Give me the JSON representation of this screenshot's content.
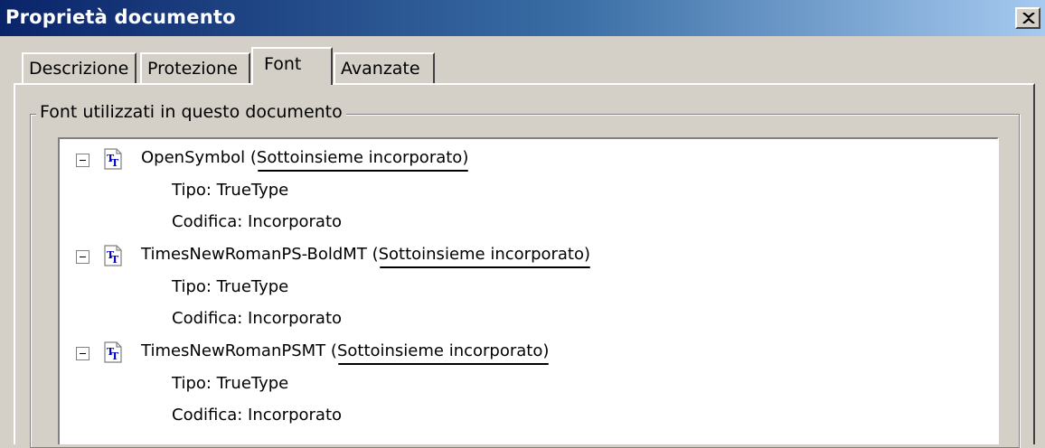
{
  "window": {
    "title": "Proprietà documento",
    "close_glyph": "×"
  },
  "tabs": [
    {
      "label": "Descrizione"
    },
    {
      "label": "Protezione"
    },
    {
      "label": "Font",
      "active": true
    },
    {
      "label": "Avanzate"
    }
  ],
  "group": {
    "label": "Font utilizzati in questo documento"
  },
  "fonts": [
    {
      "name": "OpenSymbol",
      "embed": "(Sottoinsieme incorporato)",
      "type": "Tipo: TrueType",
      "encoding": "Codifica: Incorporato"
    },
    {
      "name": "TimesNewRomanPS-BoldMT",
      "embed": "(Sottoinsieme incorporato)",
      "type": "Tipo: TrueType",
      "encoding": "Codifica: Incorporato"
    },
    {
      "name": "TimesNewRomanPSMT",
      "embed": "(Sottoinsieme incorporato)",
      "type": "Tipo: TrueType",
      "encoding": "Codifica: Incorporato"
    }
  ],
  "icons": {
    "expander": "minus-box-icon",
    "font": "truetype-font-icon",
    "close": "close-icon"
  },
  "colors": {
    "titlebar_start": "#0a246a",
    "titlebar_end": "#a6caf0",
    "dialog_bg": "#d4d0c8",
    "icon_blue": "#0000c8"
  }
}
